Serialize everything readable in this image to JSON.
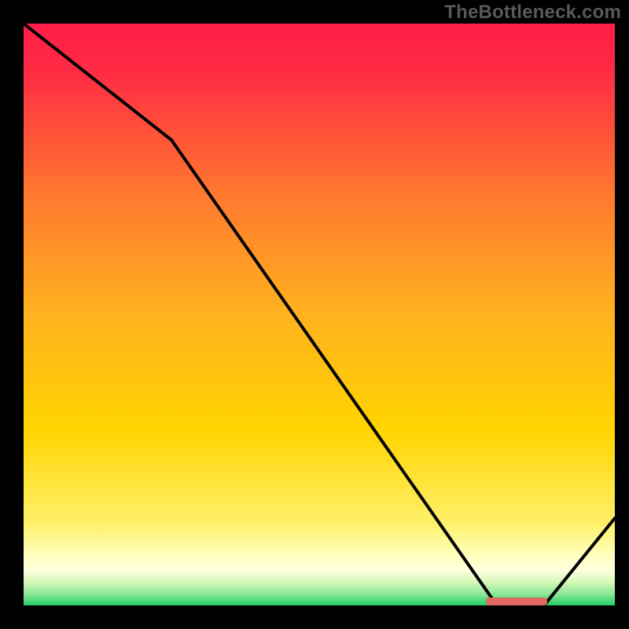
{
  "watermark": "TheBottleneck.com",
  "chart_data": {
    "type": "line",
    "title": "",
    "xlabel": "",
    "ylabel": "",
    "xlim": [
      0,
      100
    ],
    "ylim": [
      0,
      100
    ],
    "series": [
      {
        "name": "curve",
        "x": [
          0,
          25,
          80,
          88,
          100
        ],
        "y": [
          100,
          80,
          0,
          0,
          15
        ]
      }
    ],
    "marker": {
      "name": "highlight-segment",
      "x_start": 78,
      "x_end": 88,
      "y": 0,
      "color": "#e06a5f"
    },
    "background_gradient": {
      "top_color": "#ff1d46",
      "mid_color": "#ffd300",
      "pale_band": "#ffffb0",
      "bottom_color": "#26d36a"
    }
  }
}
